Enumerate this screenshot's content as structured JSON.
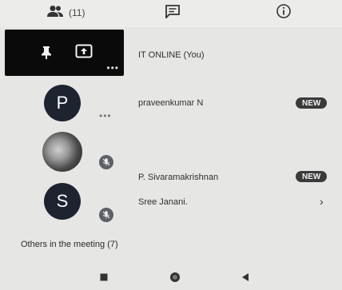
{
  "tabs": {
    "people_count": "(11)",
    "people_icon": "people-icon",
    "chat_icon": "chat-icon",
    "info_icon": "info-icon"
  },
  "self": {
    "name": "IT ONLINE (You)",
    "icons": [
      "pin-icon",
      "present-screen-icon",
      "more-options-icon"
    ]
  },
  "participants": [
    {
      "initial": "P",
      "name": "praveenkumar N",
      "badge": "NEW"
    },
    {
      "initial": "",
      "name": "P. Sivaramakrishnan",
      "badge": "NEW"
    },
    {
      "initial": "S",
      "name": "Sree Janani.",
      "badge": ""
    }
  ],
  "others_label": "Others in the meeting (7)",
  "colors": {
    "background": "#e6e6e4",
    "avatar": "#1d2430",
    "self_tile": "#0a0a0a",
    "badge": "#3a3a3a"
  }
}
